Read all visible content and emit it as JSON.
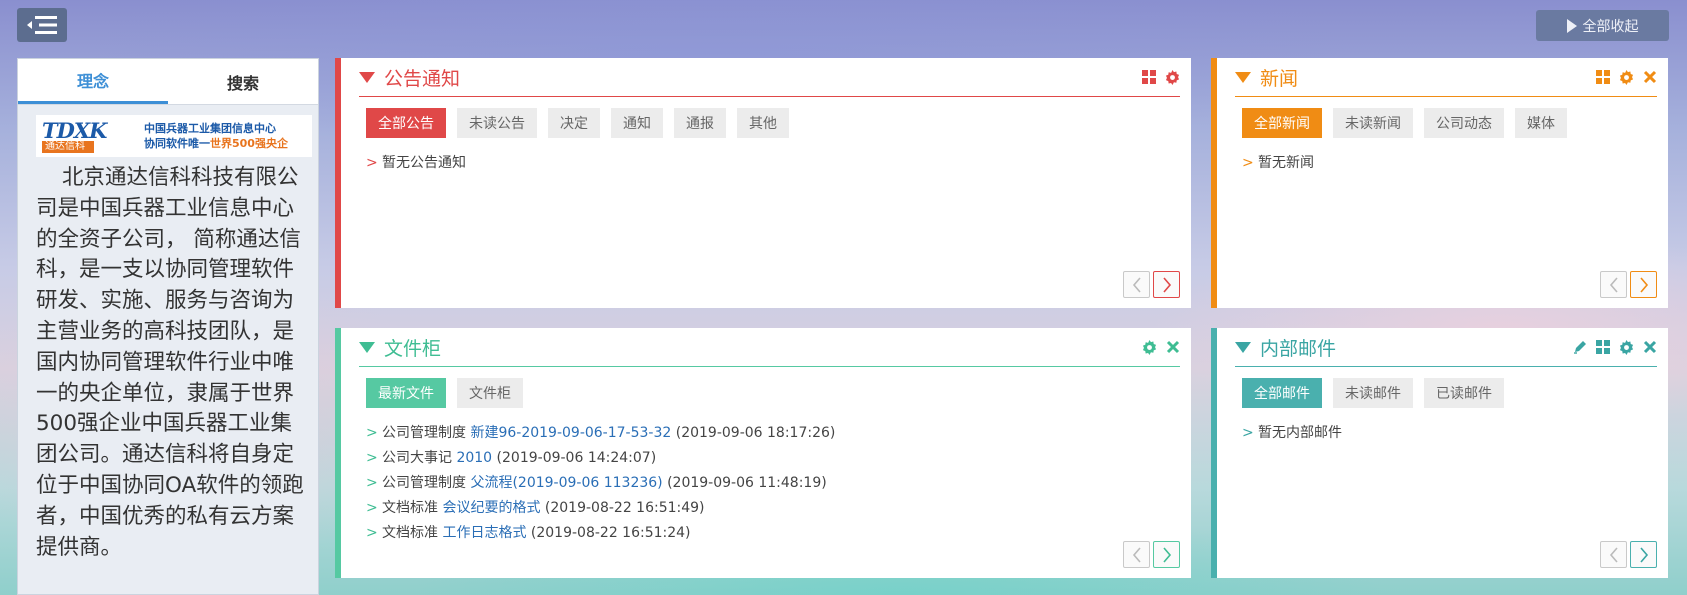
{
  "topbar": {
    "menu_icon": "menu-collapse-icon",
    "collapse_all_label": "全部收起"
  },
  "left_panel": {
    "tabs": [
      {
        "label": "理念",
        "active": true
      },
      {
        "label": "搜索",
        "active": false
      }
    ],
    "logo": {
      "mark": "TDXK",
      "sub": "通达信科",
      "line1": "中国兵器工业集团信息中心",
      "line2a": "协同软件唯一",
      "line2b": "世界500强央企"
    },
    "intro": "北京通达信科科技有限公司是中国兵器工业信息中心的全资子公司， 简称通达信科，是一支以协同管理软件研发、实施、服务与咨询为主营业务的高科技团队，是国内协同管理软件行业中唯一的央企单位，隶属于世界500强企业中国兵器工业集团公司。通达信科将自身定位于中国协同OA软件的领跑者，中国优秀的私有云方案提供商。"
  },
  "widgets": {
    "notice": {
      "title": "公告通知",
      "accent": "#e04848",
      "tools": [
        "grid-icon",
        "gear-icon"
      ],
      "tabs": [
        "全部公告",
        "未读公告",
        "决定",
        "通知",
        "通报",
        "其他"
      ],
      "empty_text": "暂无公告通知"
    },
    "news": {
      "title": "新闻",
      "accent": "#f08c14",
      "tools": [
        "grid-icon",
        "gear-icon",
        "close-icon"
      ],
      "tabs": [
        "全部新闻",
        "未读新闻",
        "公司动态",
        "媒体"
      ],
      "empty_text": "暂无新闻"
    },
    "files": {
      "title": "文件柜",
      "accent": "#56c9a2",
      "tools": [
        "gear-icon",
        "close-icon"
      ],
      "tabs": [
        "最新文件",
        "文件柜"
      ],
      "items": [
        {
          "category": "公司管理制度",
          "name": "新建96-2019-09-06-17-53-32",
          "time": "(2019-09-06 18:17:26)"
        },
        {
          "category": "公司大事记",
          "name": "2010",
          "time": "(2019-09-06 14:24:07)"
        },
        {
          "category": "公司管理制度",
          "name": "父流程(2019-09-06 113236)",
          "time": "(2019-09-06 11:48:19)"
        },
        {
          "category": "文档标准",
          "name": "会议纪要的格式",
          "time": "(2019-08-22 16:51:49)"
        },
        {
          "category": "文档标准",
          "name": "工作日志格式",
          "time": "(2019-08-22 16:51:24)"
        }
      ]
    },
    "mail": {
      "title": "内部邮件",
      "accent": "#4ab0ae",
      "tools": [
        "edit-icon",
        "grid-icon",
        "gear-icon",
        "close-icon"
      ],
      "tabs": [
        "全部邮件",
        "未读邮件",
        "已读邮件"
      ],
      "empty_text": "暂无内部邮件"
    }
  },
  "list_marker": ">"
}
